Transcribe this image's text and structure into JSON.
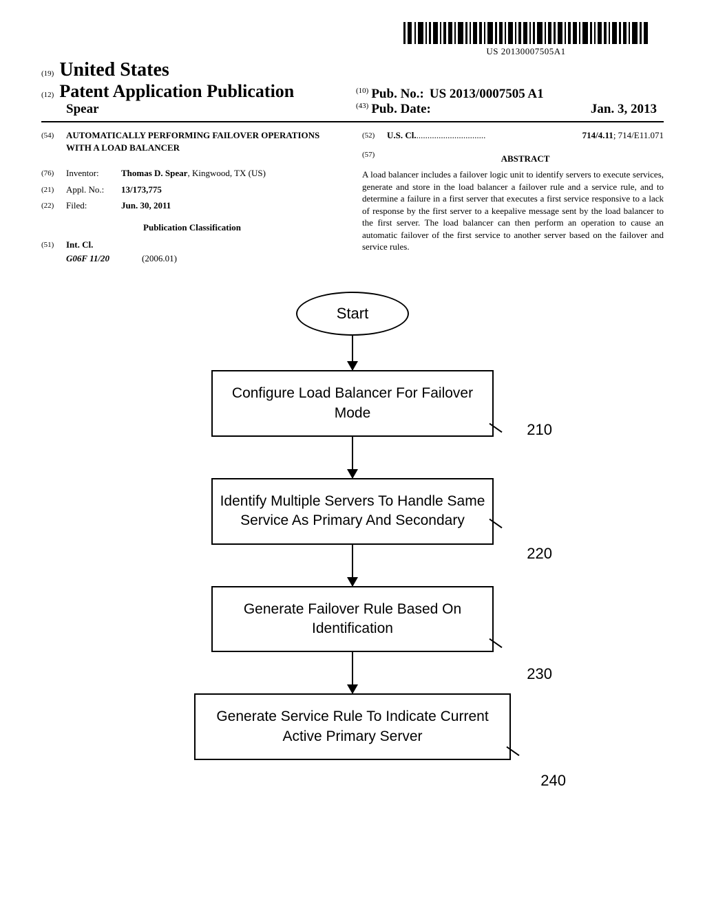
{
  "barcode_text": "US 20130007505A1",
  "header": {
    "num19": "(19)",
    "country": "United States",
    "num12": "(12)",
    "pub_type": "Patent Application Publication",
    "inventor_header": "Spear",
    "num10": "(10)",
    "pub_no_label": "Pub. No.:",
    "pub_no": "US 2013/0007505 A1",
    "num43": "(43)",
    "pub_date_label": "Pub. Date:",
    "pub_date": "Jan. 3, 2013"
  },
  "fields": {
    "f54_num": "(54)",
    "f54_title": "AUTOMATICALLY PERFORMING FAILOVER OPERATIONS WITH A LOAD BALANCER",
    "f76_num": "(76)",
    "f76_label": "Inventor:",
    "f76_val_name": "Thomas D. Spear",
    "f76_val_loc": ", Kingwood, TX (US)",
    "f21_num": "(21)",
    "f21_label": "Appl. No.:",
    "f21_val": "13/173,775",
    "f22_num": "(22)",
    "f22_label": "Filed:",
    "f22_val": "Jun. 30, 2011",
    "pubclass_head": "Publication Classification",
    "f51_num": "(51)",
    "f51_label": "Int. Cl.",
    "f51_code": "G06F 11/20",
    "f51_ver": "(2006.01)",
    "f52_num": "(52)",
    "f52_label": "U.S. Cl.",
    "f52_dots": " ............................... ",
    "f52_val_bold": "714/4.11",
    "f52_val_tail": "; 714/E11.071",
    "f57_num": "(57)",
    "abstract_head": "ABSTRACT",
    "abstract_body": "A load balancer includes a failover logic unit to identify servers to execute services, generate and store in the load balancer a failover rule and a service rule, and to determine a failure in a first server that executes a first service responsive to a lack of response by the first server to a keepalive message sent by the load balancer to the first server. The load balancer can then perform an operation to cause an automatic failover of the first service to another server based on the failover and service rules."
  },
  "flow": {
    "start": "Start",
    "b210": "Configure Load Balancer For Failover Mode",
    "r210": "210",
    "b220": "Identify Multiple Servers To Handle Same Service As Primary And Secondary",
    "r220": "220",
    "b230": "Generate Failover Rule Based On Identification",
    "r230": "230",
    "b240": "Generate Service Rule To Indicate Current Active Primary Server",
    "r240": "240"
  }
}
